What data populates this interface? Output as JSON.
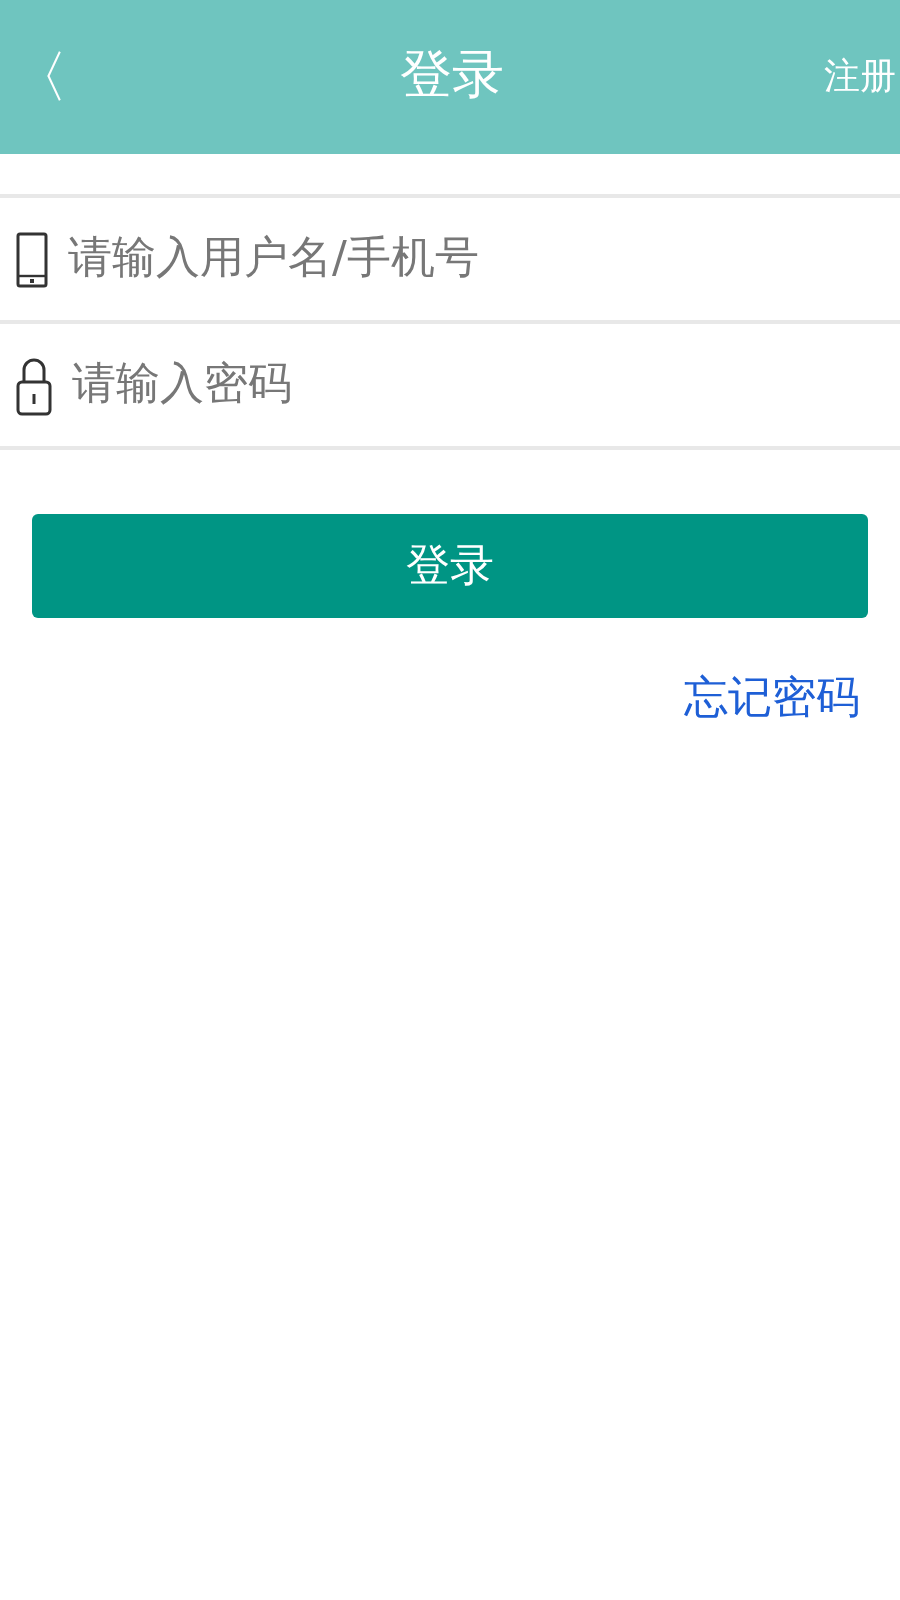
{
  "header": {
    "back": "〈",
    "title": "登录",
    "action": "注册"
  },
  "fields": [
    {
      "kind": "phone",
      "placeholder": "请输入用户名/手机号"
    },
    {
      "kind": "lock",
      "placeholder": "请输入密码"
    }
  ],
  "login_button": "登录",
  "forgot_link": "忘记密码"
}
